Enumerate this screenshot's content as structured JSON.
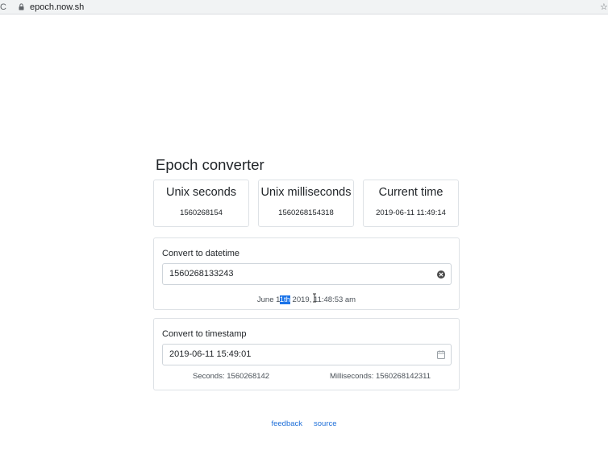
{
  "browser": {
    "url": "epoch.now.sh",
    "reload_glyph": "C",
    "star_glyph": "☆"
  },
  "page": {
    "title": "Epoch converter"
  },
  "stats": [
    {
      "title": "Unix seconds",
      "value": "1560268154"
    },
    {
      "title": "Unix milliseconds",
      "value": "1560268154318"
    },
    {
      "title": "Current time",
      "value": "2019-06-11 11:49:14"
    }
  ],
  "to_datetime": {
    "title": "Convert to datetime",
    "input_value": "1560268133243",
    "result_before": "June 1",
    "result_selected": "1th",
    "result_mid": " 2019, ",
    "result_after": "11:48:53 am",
    "clear_icon": "clear-circle-icon"
  },
  "to_timestamp": {
    "title": "Convert to timestamp",
    "input_value": "2019-06-11 15:49:01",
    "seconds_text": "Seconds: 1560268142",
    "millis_text": "Milliseconds: 1560268142311",
    "calendar_icon": "calendar-icon"
  },
  "footer": {
    "feedback_label": "feedback",
    "source_label": "source"
  },
  "colors": {
    "link": "#1e6fd9",
    "selection": "#1a73e8",
    "border": "#dee2e6"
  }
}
